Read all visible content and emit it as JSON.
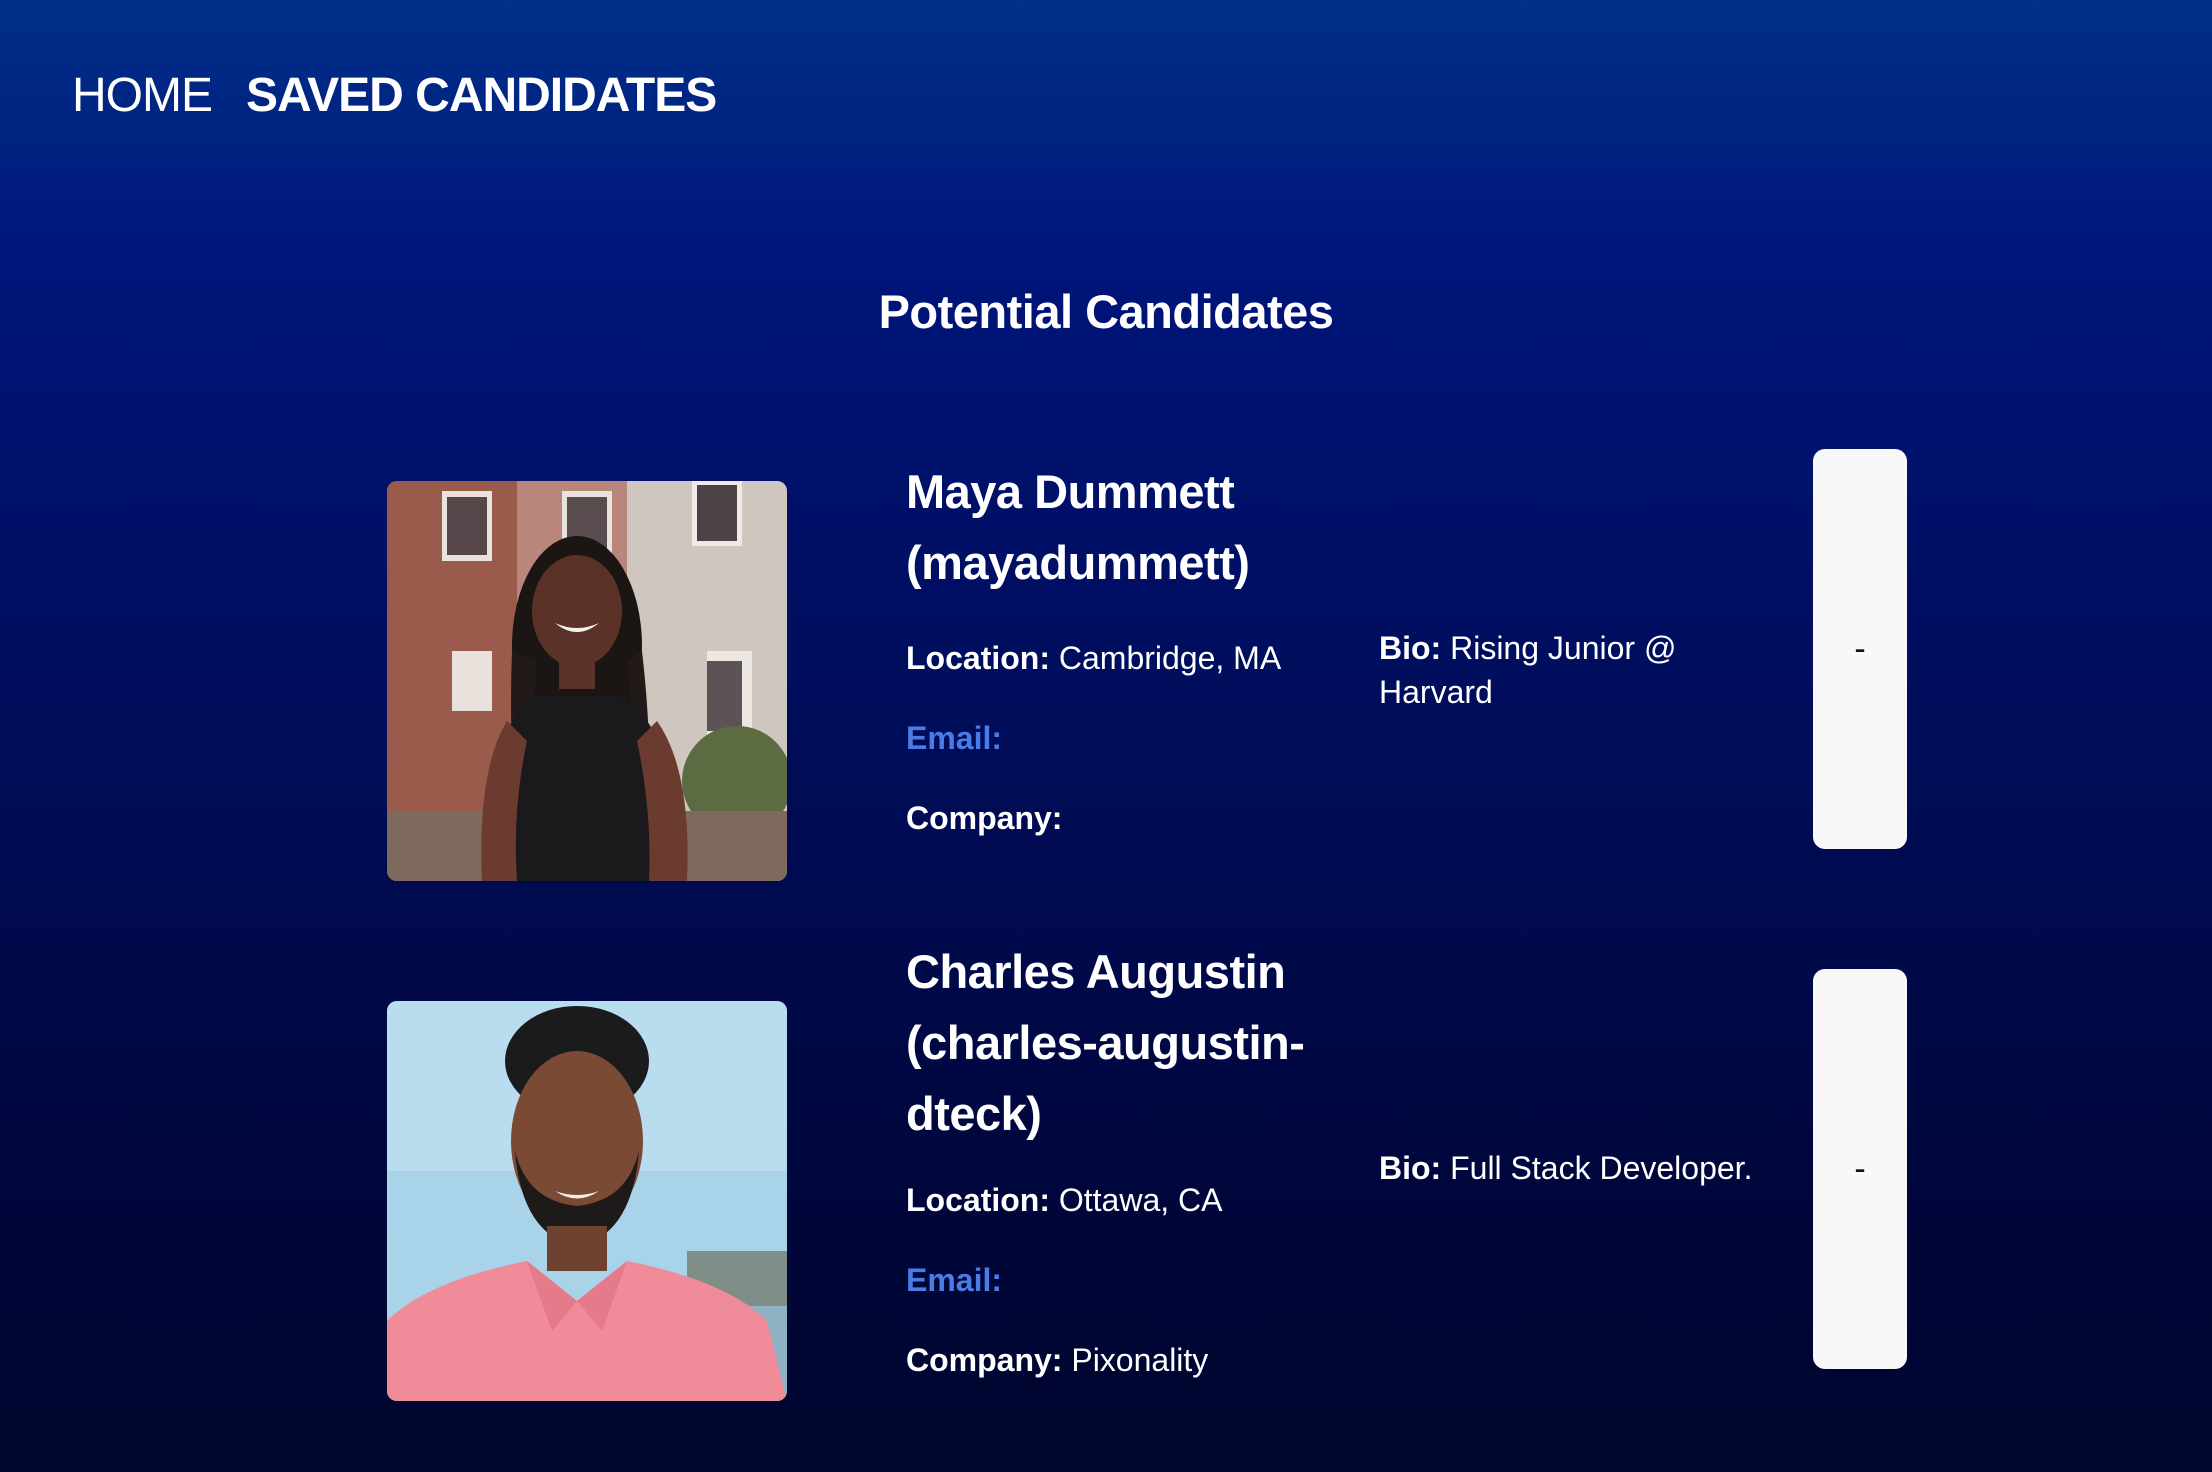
{
  "nav": {
    "home": "HOME",
    "saved": "SAVED CANDIDATES"
  },
  "page": {
    "title": "Potential Candidates"
  },
  "candidates": [
    {
      "name": "Maya Dummett (mayadummett)",
      "location_label": "Location:",
      "location": "Cambridge, MA",
      "email_label": "Email:",
      "email": "",
      "company_label": "Company:",
      "company": "",
      "bio_label": "Bio:",
      "bio": "Rising Junior @ Harvard",
      "remove_label": "-"
    },
    {
      "name": "Charles Augustin (charles-augustin-dteck)",
      "location_label": "Location:",
      "location": "Ottawa, CA",
      "email_label": "Email:",
      "email": "",
      "company_label": "Company:",
      "company": "Pixonality",
      "bio_label": "Bio:",
      "bio": "Full Stack Developer.",
      "remove_label": "-"
    }
  ],
  "colors": {
    "email_label": "#4a7ce8",
    "button_bg": "#f8f8f9",
    "background_top": "#003089",
    "background_bottom": "#00052e"
  }
}
